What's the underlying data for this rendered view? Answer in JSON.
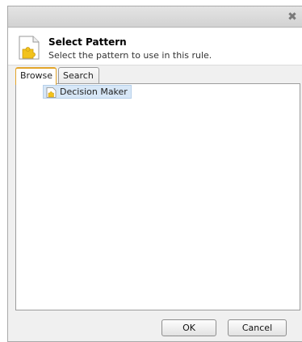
{
  "dialog": {
    "close_glyph": "✖",
    "close_icon": "close-icon",
    "header": {
      "icon": "pattern-puzzle-icon",
      "title": "Select Pattern",
      "subtitle": "Select the pattern to use in this rule."
    },
    "tabs": [
      {
        "label": "Browse",
        "active": true
      },
      {
        "label": "Search",
        "active": false
      }
    ],
    "tree": {
      "items": [
        {
          "label": "Decision Maker",
          "icon": "pattern-icon",
          "selected": true
        }
      ]
    },
    "buttons": {
      "ok": "OK",
      "cancel": "Cancel"
    },
    "colors": {
      "accent_tab": "#e3a52a",
      "selection_bg": "#d7e7f7",
      "icon_yellow": "#f2c21b"
    }
  }
}
